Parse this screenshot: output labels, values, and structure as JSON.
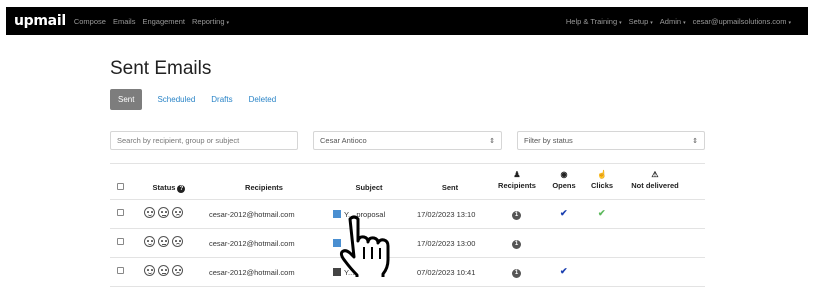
{
  "navbar": {
    "logo": "upmail",
    "left_items": [
      "Compose",
      "Emails",
      "Engagement",
      "Reporting"
    ],
    "right_items": [
      "Help & Training",
      "Setup",
      "Admin",
      "cesar@upmailsolutions.com"
    ]
  },
  "page": {
    "title": "Sent Emails"
  },
  "tabs": [
    "Sent",
    "Scheduled",
    "Drafts",
    "Deleted"
  ],
  "filters": {
    "search_placeholder": "Search by recipient, group or subject",
    "user_select": "Cesar Antioco",
    "status_select": "Filter by status"
  },
  "table": {
    "headers": {
      "status": "Status",
      "recipients": "Recipients",
      "subject": "Subject",
      "sent": "Sent",
      "recipients_count": "Recipients",
      "opens": "Opens",
      "clicks": "Clicks",
      "not_delivered": "Not delivered"
    },
    "rows": [
      {
        "recipient": "cesar-2012@hotmail.com",
        "subject": "Y... proposal",
        "sent": "17/02/2023 13:10",
        "recipients_count": "1",
        "opened": true,
        "clicked": true
      },
      {
        "recipient": "cesar-2012@hotmail.com",
        "subject": "",
        "sent": "17/02/2023 13:00",
        "recipients_count": "1",
        "opened": false,
        "clicked": false
      },
      {
        "recipient": "cesar-2012@hotmail.com",
        "subject": "Y... sal",
        "sent": "07/02/2023 10:41",
        "recipients_count": "1",
        "opened": true,
        "clicked": false
      }
    ]
  },
  "colors": {
    "navbar_bg": "#000000",
    "link": "#2a84c7",
    "active_tab": "#7d7d7d",
    "open_check": "#1a3fb0",
    "click_check": "#5cb85c"
  }
}
